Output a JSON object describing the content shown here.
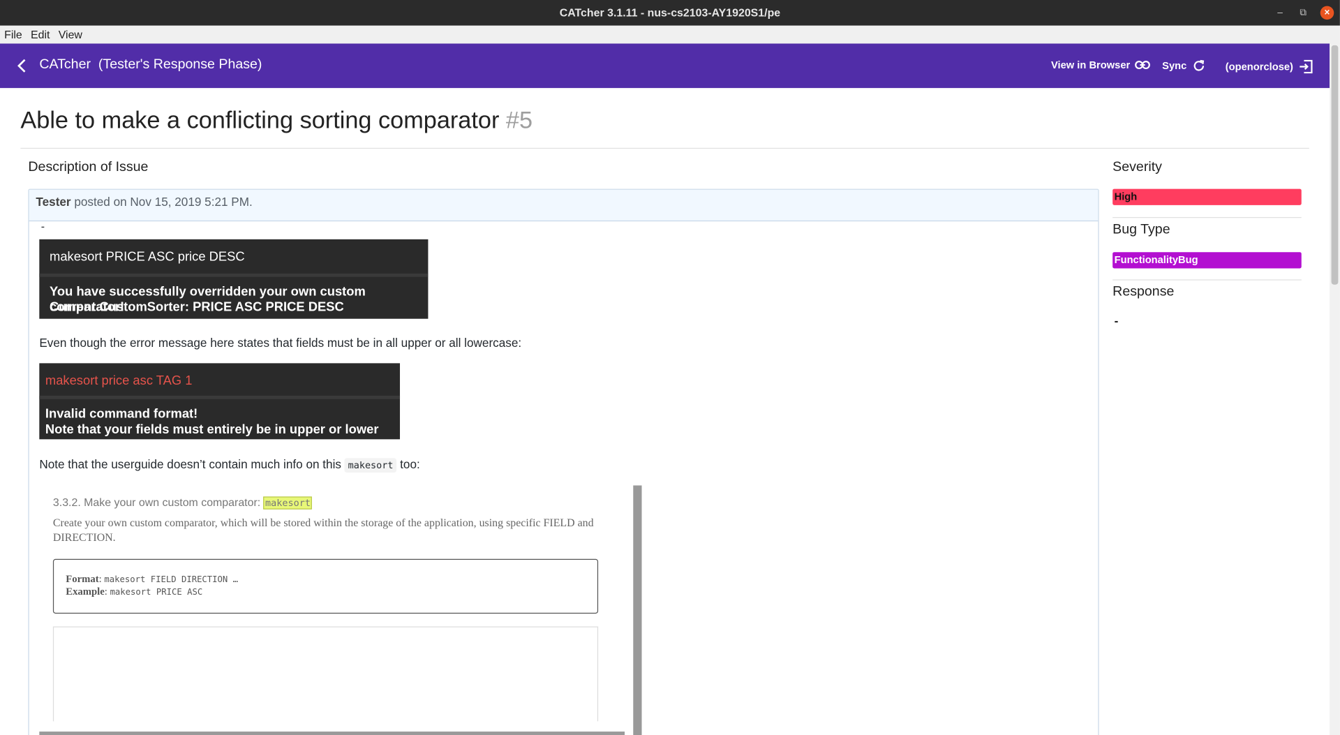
{
  "window": {
    "title": "CATcher 3.1.11 - nus-cs2103-AY1920S1/pe",
    "minimize": "–",
    "restore": "⧉",
    "close": "×"
  },
  "menu": {
    "items": [
      "File",
      "Edit",
      "View"
    ]
  },
  "toolbar": {
    "app_name": "CATcher",
    "phase": "(Tester's Response Phase)",
    "view_in_browser": "View in Browser",
    "sync": "Sync",
    "logout": "(openorclose)"
  },
  "issue": {
    "title": "Able to make a conflicting sorting comparator",
    "number": "#5"
  },
  "description": {
    "heading": "Description of Issue",
    "author": "Tester",
    "posted": "posted on Nov 15, 2019 5:21 PM.",
    "dash": "-",
    "screenshot1": {
      "command": "makesort PRICE ASC price DESC",
      "output_line1": "You have successfully overridden your own custom comparator!",
      "output_line2": "Current CustomSorter: PRICE ASC PRICE DESC"
    },
    "para1": "Even though the error message here states that fields must be in all upper or all lowercase:",
    "screenshot2": {
      "command": "makesort price asc TAG 1",
      "output_line1": "Invalid command format!",
      "output_line2": "Note that your fields must entirely be in upper or lower case!"
    },
    "para2_before": "Note that the userguide doesn’t contain much info on this",
    "para2_code": "makesort",
    "para2_after": "too:",
    "guide": {
      "heading": "3.3.2. Make your own custom comparator:",
      "heading_code": "makesort",
      "text": "Create your own custom comparator, which will be stored within the storage of the application, using specific FIELD and DIRECTION.",
      "format_label": "Format",
      "format_value": "makesort FIELD DIRECTION …",
      "example_label": "Example",
      "example_value": "makesort PRICE ASC"
    }
  },
  "sidebar": {
    "severity_heading": "Severity",
    "severity_value": "High",
    "severity_color": "#ff3d5f",
    "bugtype_heading": "Bug Type",
    "bugtype_value": "FunctionalityBug",
    "bugtype_color": "#b30fd1",
    "response_heading": "Response",
    "response_value": "-"
  },
  "colors": {
    "toolbar": "#512da8",
    "titlebar": "#2b2b2b",
    "close_button": "#e95420"
  }
}
